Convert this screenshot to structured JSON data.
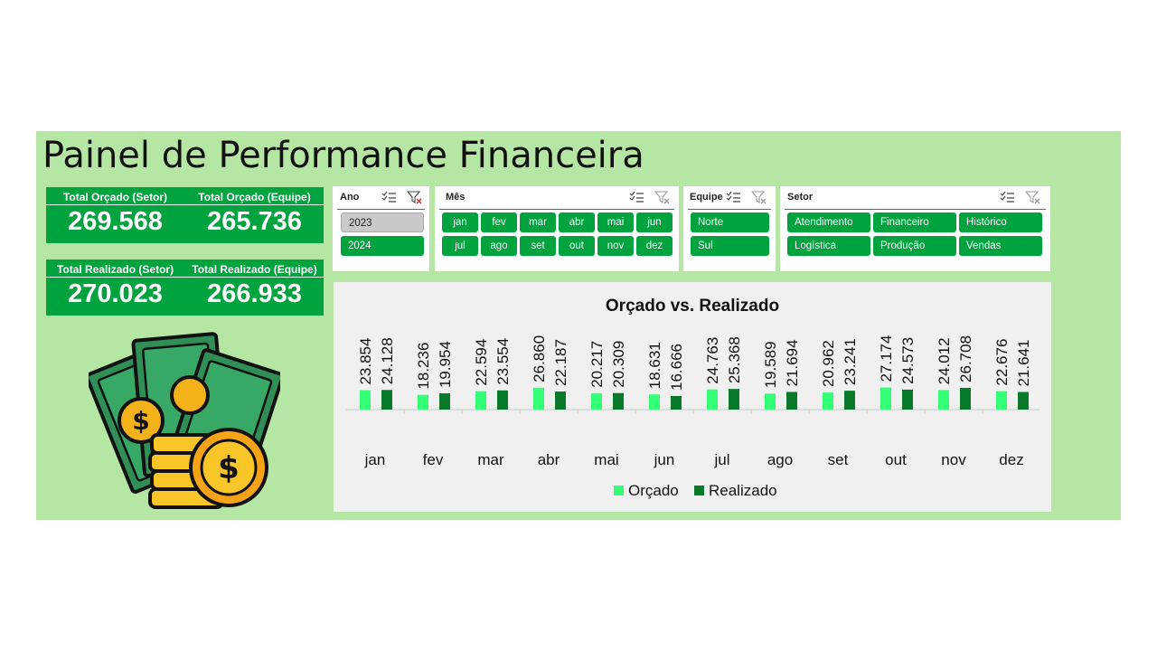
{
  "title": "Painel de Performance Financeira",
  "kpis": {
    "orcado_setor_label": "Total Orçado (Setor)",
    "orcado_setor_value": "269.568",
    "orcado_equipe_label": "Total Orçado (Equipe)",
    "orcado_equipe_value": "265.736",
    "realizado_setor_label": "Total Realizado (Setor)",
    "realizado_setor_value": "270.023",
    "realizado_equipe_label": "Total Realizado (Equipe)",
    "realizado_equipe_value": "266.933"
  },
  "slicers": {
    "ano": {
      "header": "Ano",
      "items": [
        "2023",
        "2024"
      ],
      "selected": [
        "2024"
      ]
    },
    "mes": {
      "header": "Mês",
      "items": [
        "jan",
        "fev",
        "mar",
        "abr",
        "mai",
        "jun",
        "jul",
        "ago",
        "set",
        "out",
        "nov",
        "dez"
      ]
    },
    "equipe": {
      "header": "Equipe",
      "items": [
        "Norte",
        "Sul"
      ]
    },
    "setor": {
      "header": "Setor",
      "items": [
        "Atendimento",
        "Financeiro",
        "Histórico",
        "Logística",
        "Produção",
        "Vendas"
      ]
    }
  },
  "icons": {
    "multi_select": "multi-select-icon",
    "clear_filter": "clear-filter-icon",
    "illustration": "money-illustration"
  },
  "colors": {
    "panel_bg": "#b6e6a4",
    "accent": "#00a33e",
    "orcado": "#33ff77",
    "realizado": "#087a2a"
  },
  "chart_data": {
    "type": "bar",
    "title": "Orçado vs. Realizado",
    "categories": [
      "jan",
      "fev",
      "mar",
      "abr",
      "mai",
      "jun",
      "jul",
      "ago",
      "set",
      "out",
      "nov",
      "dez"
    ],
    "series": [
      {
        "name": "Orçado",
        "values": [
          "23.854",
          "18.236",
          "22.594",
          "26.860",
          "20.217",
          "18.631",
          "24.763",
          "19.589",
          "20.962",
          "27.174",
          "24.012",
          "22.676"
        ]
      },
      {
        "name": "Realizado",
        "values": [
          "24.128",
          "19.954",
          "23.554",
          "22.187",
          "20.309",
          "16.666",
          "25.368",
          "21.694",
          "23.241",
          "24.573",
          "26.708",
          "21.641"
        ]
      }
    ],
    "legend": "bottom",
    "grid": false
  }
}
